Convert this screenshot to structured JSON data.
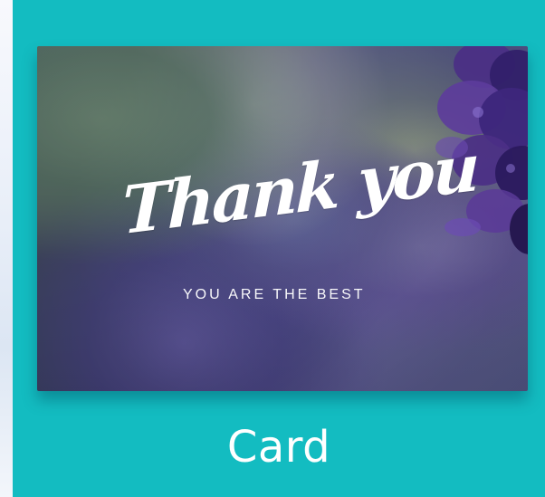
{
  "card_preview": {
    "title": "Thank you",
    "subtitle": "YOU ARE THE BEST"
  },
  "tile": {
    "label": "Card"
  },
  "colors": {
    "tile_background": "#13bcc1",
    "page_background": "#eef3f8"
  }
}
